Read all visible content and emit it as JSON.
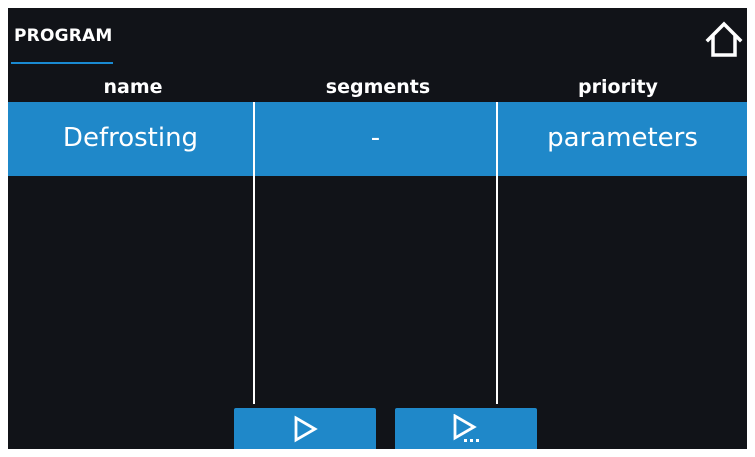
{
  "header": {
    "title": "PROGRAM",
    "home_icon": "home-icon"
  },
  "table": {
    "columns": [
      "name",
      "segments",
      "priority"
    ],
    "rows": [
      {
        "name": "Defrosting",
        "segments": "-",
        "priority": "parameters"
      }
    ]
  },
  "footer": {
    "buttons": [
      {
        "icon": "play-icon"
      },
      {
        "icon": "play-more-icon"
      }
    ]
  },
  "colors": {
    "background": "#111318",
    "accent": "#1f88c9",
    "text": "#ffffff"
  }
}
